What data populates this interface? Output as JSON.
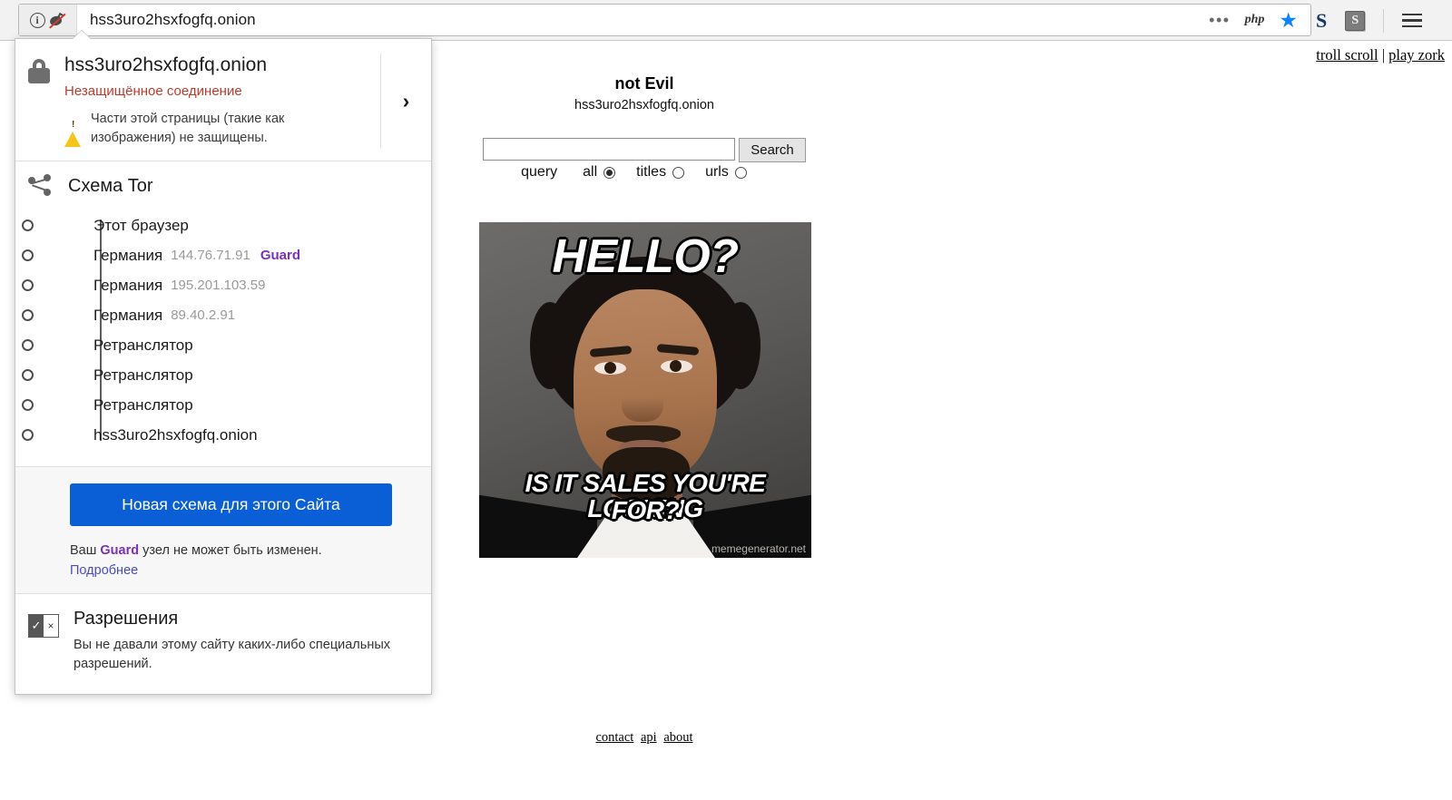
{
  "browser": {
    "url": "hss3uro2hsxfogfq.onion",
    "toolbar_icons": {
      "info": "info-circle-icon",
      "onion_disabled": "onion-crossed-icon",
      "overflow": "•••",
      "php": "php",
      "bookmark_star": "★",
      "ext_s": "S",
      "ext_s_box": "S",
      "menu": "hamburger-menu-icon"
    }
  },
  "panel": {
    "identity": {
      "host": "hss3uro2hsxfogfq.onion",
      "connection_status": "Незащищённое соединение",
      "mixed_content_warning": "Части этой страницы (такие как изображения) не защищены.",
      "expand_chevron": "›"
    },
    "circuit": {
      "title": "Схема Tor",
      "nodes": [
        {
          "label": "Этот браузер",
          "ip": "",
          "tag": ""
        },
        {
          "label": "Германия",
          "ip": "144.76.71.91",
          "tag": "Guard"
        },
        {
          "label": "Германия",
          "ip": "195.201.103.59",
          "tag": ""
        },
        {
          "label": "Германия",
          "ip": "89.40.2.91",
          "tag": ""
        },
        {
          "label": "Ретранслятор",
          "ip": "",
          "tag": ""
        },
        {
          "label": "Ретранслятор",
          "ip": "",
          "tag": ""
        },
        {
          "label": "Ретранслятор",
          "ip": "",
          "tag": ""
        },
        {
          "label": "hss3uro2hsxfogfq.onion",
          "ip": "",
          "tag": ""
        }
      ]
    },
    "new_circuit": {
      "button_label": "Новая схема для этого Сайта",
      "note_before": "Ваш ",
      "note_guard": "Guard",
      "note_after": " узел не может быть изменен.",
      "learn_more": "Подробнее"
    },
    "permissions": {
      "title": "Разрешения",
      "description": "Вы не давали этому сайту каких-либо специальных разрешений."
    }
  },
  "page": {
    "top_links": {
      "troll": "troll scroll",
      "sep": " | ",
      "zork": "play zork"
    },
    "title": "not Evil",
    "host": "hss3uro2hsxfogfq.onion",
    "search": {
      "value": "",
      "placeholder": "",
      "button_label": "Search"
    },
    "options": {
      "label": "query",
      "items": [
        {
          "label": "all",
          "selected": true
        },
        {
          "label": "titles",
          "selected": false
        },
        {
          "label": "urls",
          "selected": false
        }
      ]
    },
    "meme": {
      "top_text": "HELLO?",
      "bottom_text_line1": "IS IT SALES YOU'RE LOOKING",
      "bottom_text_line2": "FOR?",
      "watermark": "memegenerator.net"
    },
    "footer": {
      "contact": "contact",
      "api": "api",
      "about": "about"
    }
  },
  "colors": {
    "accent_blue": "#0a5fd6",
    "guard_purple": "#7b2fbe",
    "insecure_red": "#c0392b",
    "warning_yellow": "#f5c518",
    "link_blue": "#4a4ac9"
  }
}
